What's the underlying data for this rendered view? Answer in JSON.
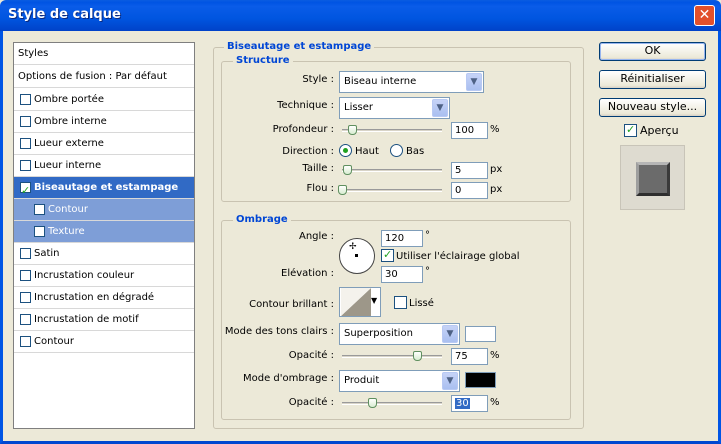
{
  "window": {
    "title": "Style de calque",
    "close_glyph": "✕"
  },
  "styles_panel": {
    "header": "Styles",
    "blend_options": "Options de fusion : Par défaut",
    "items": [
      {
        "label": "Ombre portée",
        "checked": false
      },
      {
        "label": "Ombre interne",
        "checked": false
      },
      {
        "label": "Lueur externe",
        "checked": false
      },
      {
        "label": "Lueur interne",
        "checked": false
      },
      {
        "label": "Biseautage et estampage",
        "checked": true,
        "selected": true
      },
      {
        "label": "Contour",
        "checked": false,
        "sub": true
      },
      {
        "label": "Texture",
        "checked": false,
        "sub": true
      },
      {
        "label": "Satin",
        "checked": false
      },
      {
        "label": "Incrustation couleur",
        "checked": false
      },
      {
        "label": "Incrustation en dégradé",
        "checked": false
      },
      {
        "label": "Incrustation de motif",
        "checked": false
      },
      {
        "label": "Contour",
        "checked": false
      }
    ]
  },
  "bevel": {
    "title": "Biseautage et estampage",
    "structure": {
      "title": "Structure",
      "style_label": "Style :",
      "style_value": "Biseau interne",
      "technique_label": "Technique :",
      "technique_value": "Lisser",
      "depth_label": "Profondeur :",
      "depth_value": "100",
      "depth_unit": "%",
      "direction_label": "Direction :",
      "direction_up": "Haut",
      "direction_down": "Bas",
      "size_label": "Taille :",
      "size_value": "5",
      "size_unit": "px",
      "soften_label": "Flou :",
      "soften_value": "0",
      "soften_unit": "px"
    },
    "shading": {
      "title": "Ombrage",
      "angle_label": "Angle :",
      "angle_value": "120",
      "angle_unit": "°",
      "global_light_label": "Utiliser l'éclairage global",
      "altitude_label": "Elévation :",
      "altitude_value": "30",
      "altitude_unit": "°",
      "gloss_label": "Contour brillant :",
      "antialias_label": "Lissé",
      "highlight_mode_label": "Mode des tons clairs :",
      "highlight_mode_value": "Superposition",
      "highlight_color": "#ffffff",
      "highlight_opacity_label": "Opacité :",
      "highlight_opacity_value": "75",
      "highlight_opacity_unit": "%",
      "shadow_mode_label": "Mode d'ombrage :",
      "shadow_mode_value": "Produit",
      "shadow_color": "#000000",
      "shadow_opacity_label": "Opacité :",
      "shadow_opacity_value": "30",
      "shadow_opacity_unit": "%"
    }
  },
  "buttons": {
    "ok": "OK",
    "reset": "Réinitialiser",
    "new_style": "Nouveau style...",
    "preview_label": "Aperçu"
  },
  "colors": {
    "titlebar": "#0054e3",
    "selection": "#316ac5",
    "group_title": "#0046d5",
    "check": "#21a121"
  },
  "sliders": {
    "depth_fraction": 0.08,
    "size_fraction": 0.05,
    "soften_fraction": 0.0,
    "highlight_opacity_fraction": 0.75,
    "shadow_opacity_fraction": 0.3
  }
}
